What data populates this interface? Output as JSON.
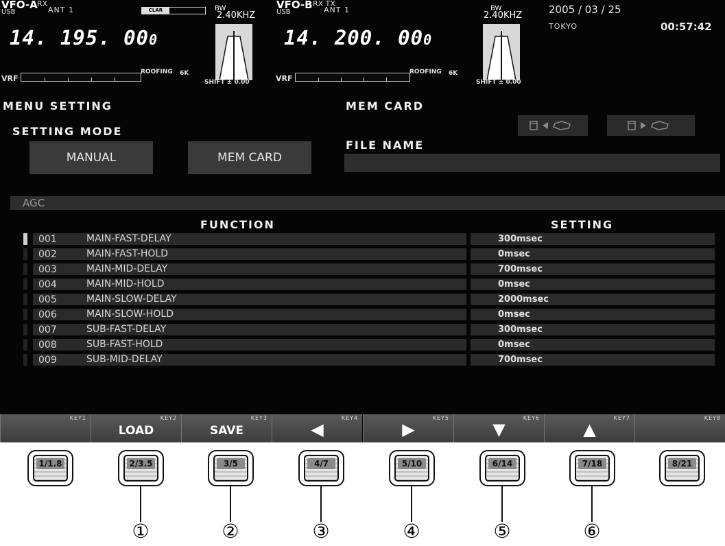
{
  "vfo_a": {
    "title": "VFO-A",
    "flags": "RX",
    "mode": "USB",
    "ant": "ANT 1",
    "clar": "CLAR",
    "freq": "14. 195. 00",
    "freq_small": "0",
    "bw_label": "BW",
    "bw_value": "2.40KHZ",
    "shift": "SHIFT ± 0.00",
    "vrf": "VRF",
    "roofing": "ROOFING",
    "roofing_bw": "6K"
  },
  "vfo_b": {
    "title": "VFO-B",
    "flags": "RX TX",
    "mode": "USB",
    "ant": "ANT 1",
    "freq": "14. 200. 00",
    "freq_small": "0",
    "bw_label": "BW",
    "bw_value": "2.40KHZ",
    "shift": "SHIFT ± 0.00",
    "vrf": "VRF",
    "roofing": "ROOFING",
    "roofing_bw": "6K"
  },
  "clock": {
    "date": "2005 / 03 / 25",
    "city": "TOKYO",
    "time": "00:57:42"
  },
  "menu": {
    "title": "MENU  SETTING",
    "setting_mode_label": "SETTING  MODE",
    "manual_button": "MANUAL",
    "memcard_button": "MEM CARD",
    "mem_card_title": "MEM  CARD",
    "file_name_label": "FILE  NAME",
    "file_name_value": "",
    "section": "AGC",
    "col_function": "FUNCTION",
    "col_setting": "SETTING"
  },
  "rows": [
    {
      "num": "001",
      "name": "MAIN-FAST-DELAY",
      "value": "300msec"
    },
    {
      "num": "002",
      "name": "MAIN-FAST-HOLD",
      "value": "0msec"
    },
    {
      "num": "003",
      "name": "MAIN-MID-DELAY",
      "value": "700msec"
    },
    {
      "num": "004",
      "name": "MAIN-MID-HOLD",
      "value": "0msec"
    },
    {
      "num": "005",
      "name": "MAIN-SLOW-DELAY",
      "value": "2000msec"
    },
    {
      "num": "006",
      "name": "MAIN-SLOW-HOLD",
      "value": "0msec"
    },
    {
      "num": "007",
      "name": "SUB-FAST-DELAY",
      "value": "300msec"
    },
    {
      "num": "008",
      "name": "SUB-FAST-HOLD",
      "value": "0msec"
    },
    {
      "num": "009",
      "name": "SUB-MID-DELAY",
      "value": "700msec"
    }
  ],
  "softkeys": [
    {
      "key": "KEY1",
      "label": ""
    },
    {
      "key": "KEY2",
      "label": "LOAD"
    },
    {
      "key": "KEY3",
      "label": "SAVE"
    },
    {
      "key": "KEY4",
      "label": "◀"
    },
    {
      "key": "KEY5",
      "label": "▶"
    },
    {
      "key": "KEY6",
      "label": "▼"
    },
    {
      "key": "KEY7",
      "label": "▲"
    },
    {
      "key": "KEY8",
      "label": ""
    }
  ],
  "hardware_buttons": [
    "1/1.8",
    "2/3.5",
    "3/5",
    "4/7",
    "5/10",
    "6/14",
    "7/18",
    "8/21"
  ],
  "callouts": [
    "①",
    "②",
    "③",
    "④",
    "⑤",
    "⑥"
  ],
  "icons": {
    "card_to_left": "memory-card-load-icon",
    "card_to_right": "memory-card-save-icon"
  }
}
